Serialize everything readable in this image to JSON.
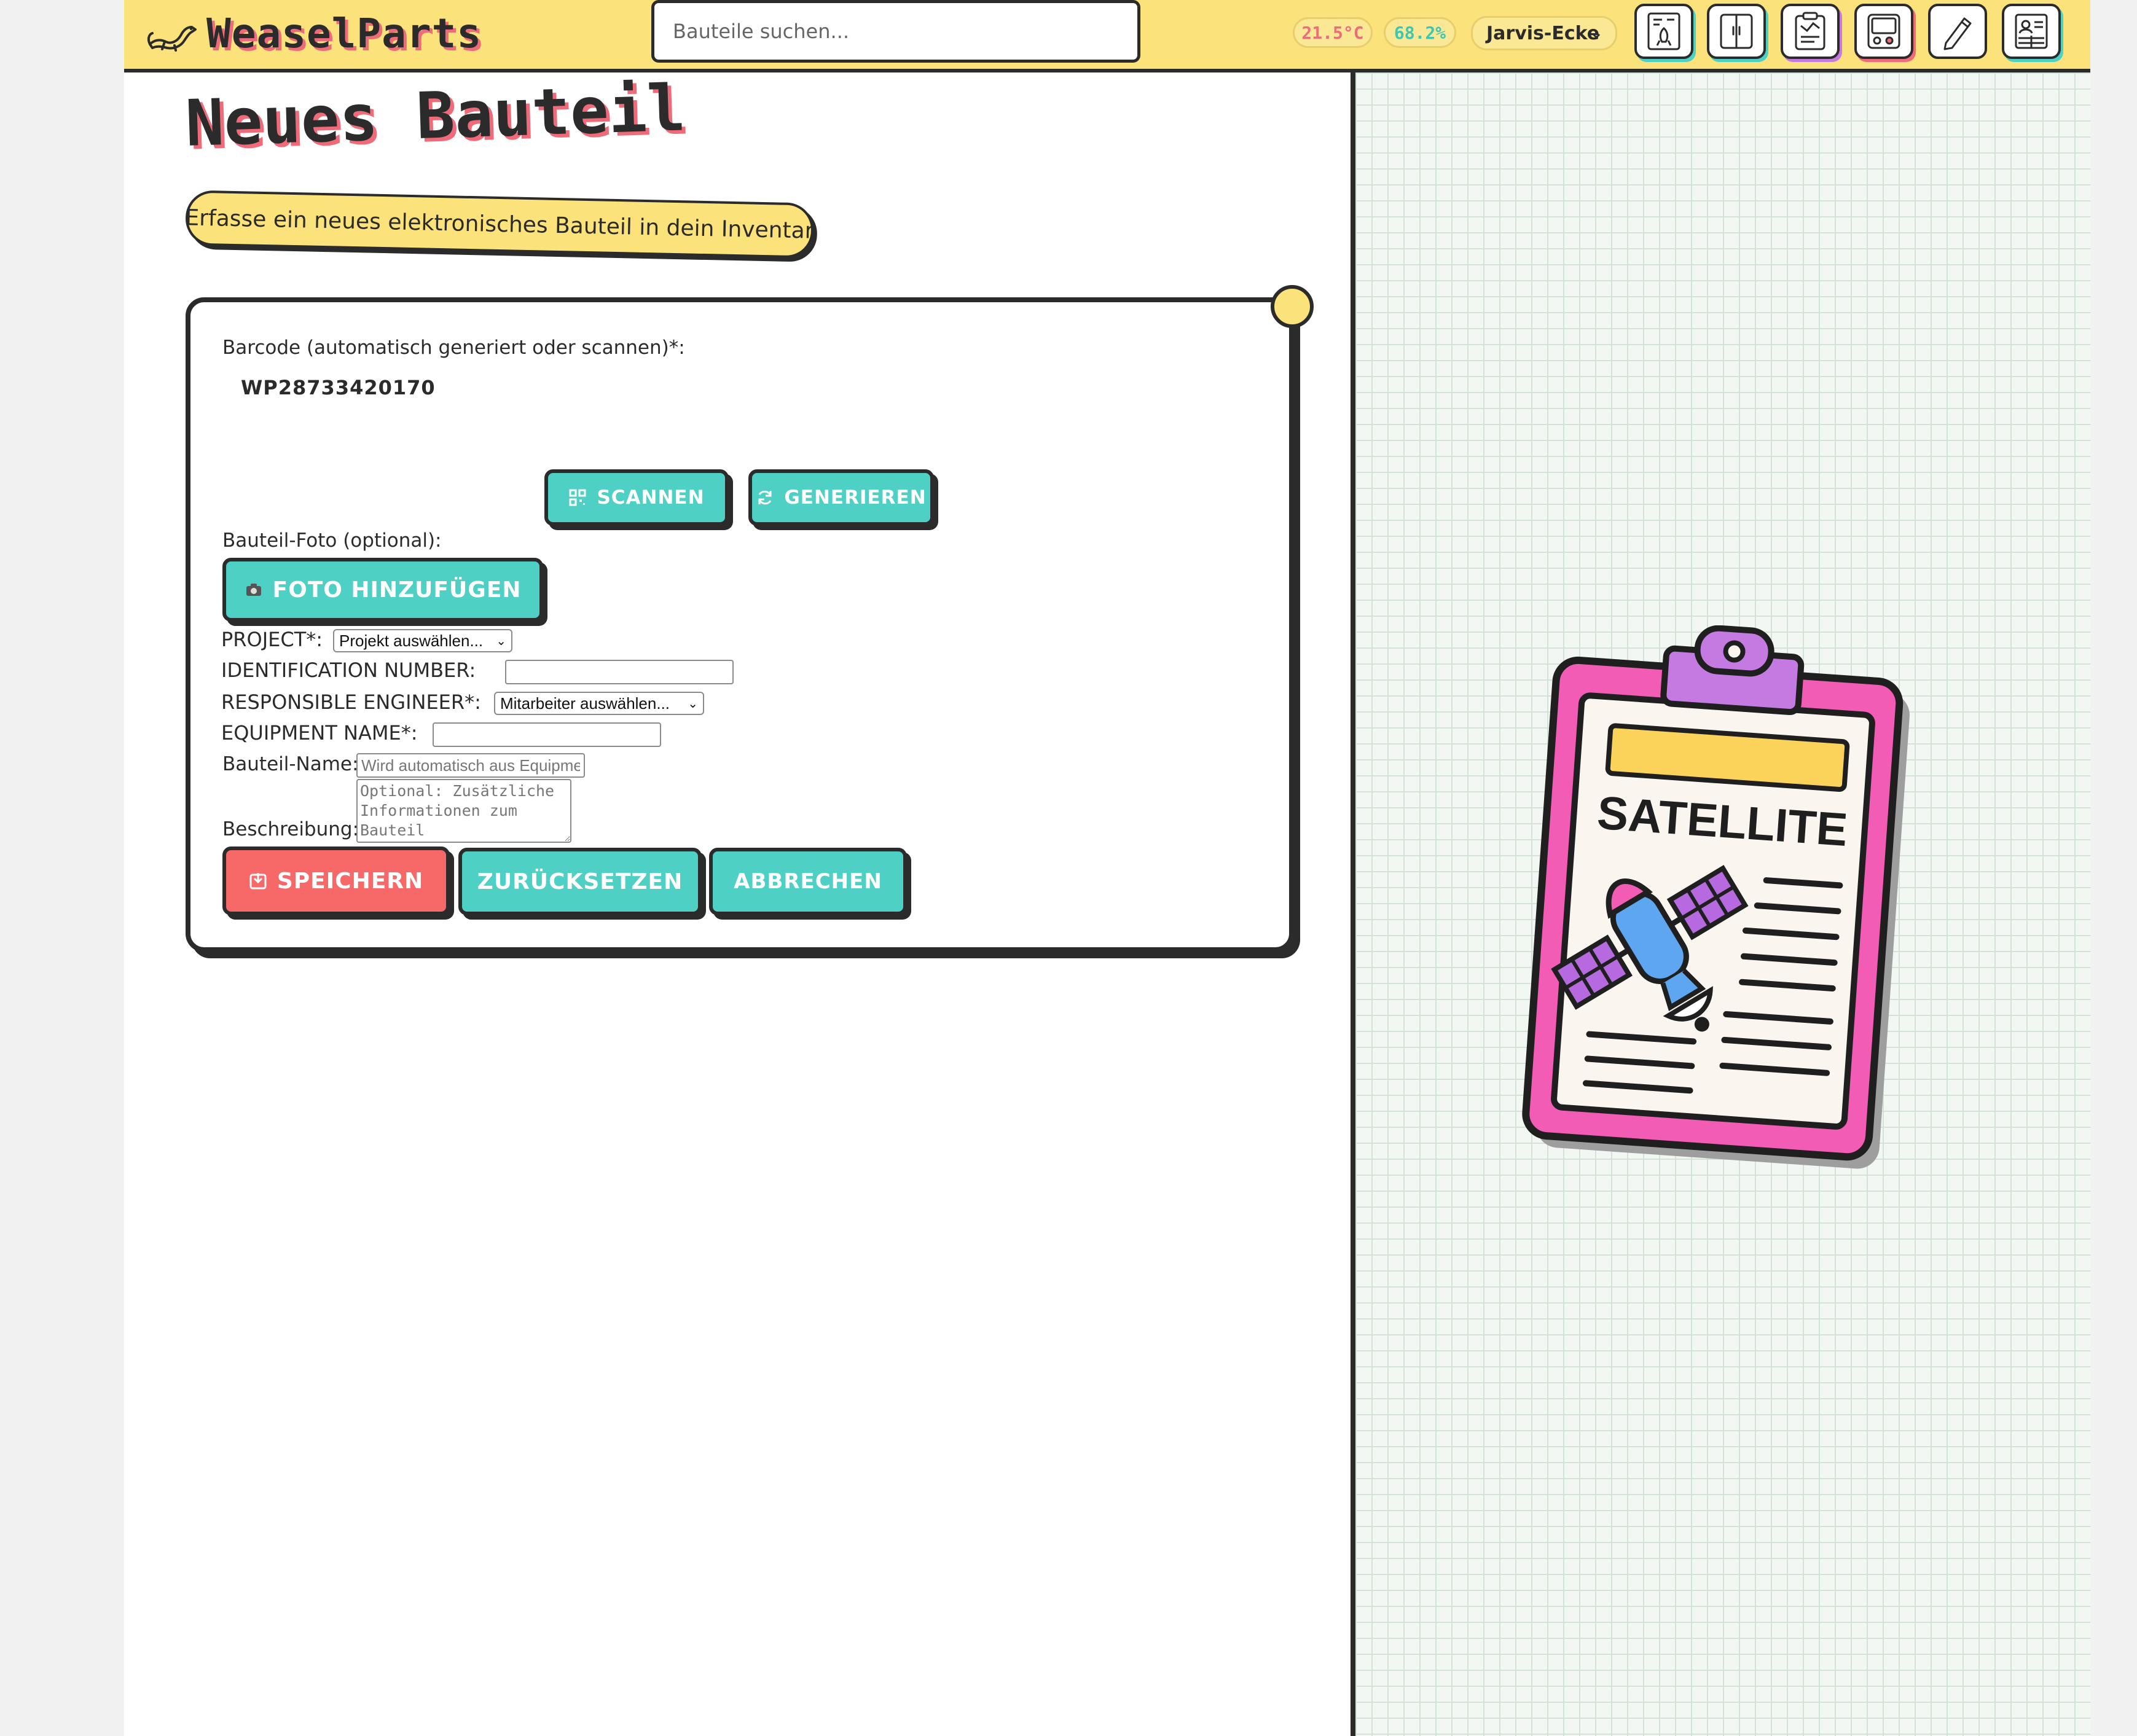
{
  "header": {
    "brand": "WeaselParts",
    "search_placeholder": "Bauteile suchen...",
    "temperature": "21.5°C",
    "humidity": "68.2%",
    "location": "Jarvis-Ecke",
    "nav_icons": [
      "rocket-document-icon",
      "cabinet-icon",
      "clipboard-icon",
      "device-icon",
      "pencil-icon",
      "id-card-icon"
    ]
  },
  "page": {
    "title": "Neues Bauteil",
    "subtitle": "Erfasse ein neues elektronisches Bauteil in dein Inventar"
  },
  "form": {
    "barcode_label": "Barcode (automatisch generiert oder scannen)*:",
    "barcode_value": "WP28733420170",
    "scan_label": "SCANNEN",
    "generate_label": "GENERIEREN",
    "photo_label": "Bauteil-Foto (optional):",
    "photo_button": "FOTO HINZUFÜGEN",
    "project_label": "PROJECT*:",
    "project_selected": "Projekt auswählen...",
    "id_number_label": "IDENTIFICATION NUMBER:",
    "id_number_value": "",
    "engineer_label": "RESPONSIBLE ENGINEER*:",
    "engineer_selected": "Mitarbeiter auswählen...",
    "equipment_label": "EQUIPMENT NAME*:",
    "equipment_value": "",
    "part_name_label": "Bauteil-Name:",
    "part_name_placeholder": "Wird automatisch aus Equipment-Name generiert",
    "description_label": "Beschreibung:",
    "description_placeholder": "Optional: Zusätzliche Informationen zum Bauteil",
    "save_label": "SPEICHERN",
    "reset_label": "ZURÜCKSETZEN",
    "cancel_label": "ABBRECHEN"
  },
  "illustration": {
    "caption": "SATELLITE",
    "icon": "satellite-clipboard-icon"
  },
  "colors": {
    "header_bg": "#fbe27a",
    "ink": "#2b2b2b",
    "accent_pink": "#f06b7a",
    "teal": "#4fd0c4",
    "red": "#f76868",
    "clipboard_pink": "#f25cb5",
    "clip_purple": "#c47ae0"
  }
}
